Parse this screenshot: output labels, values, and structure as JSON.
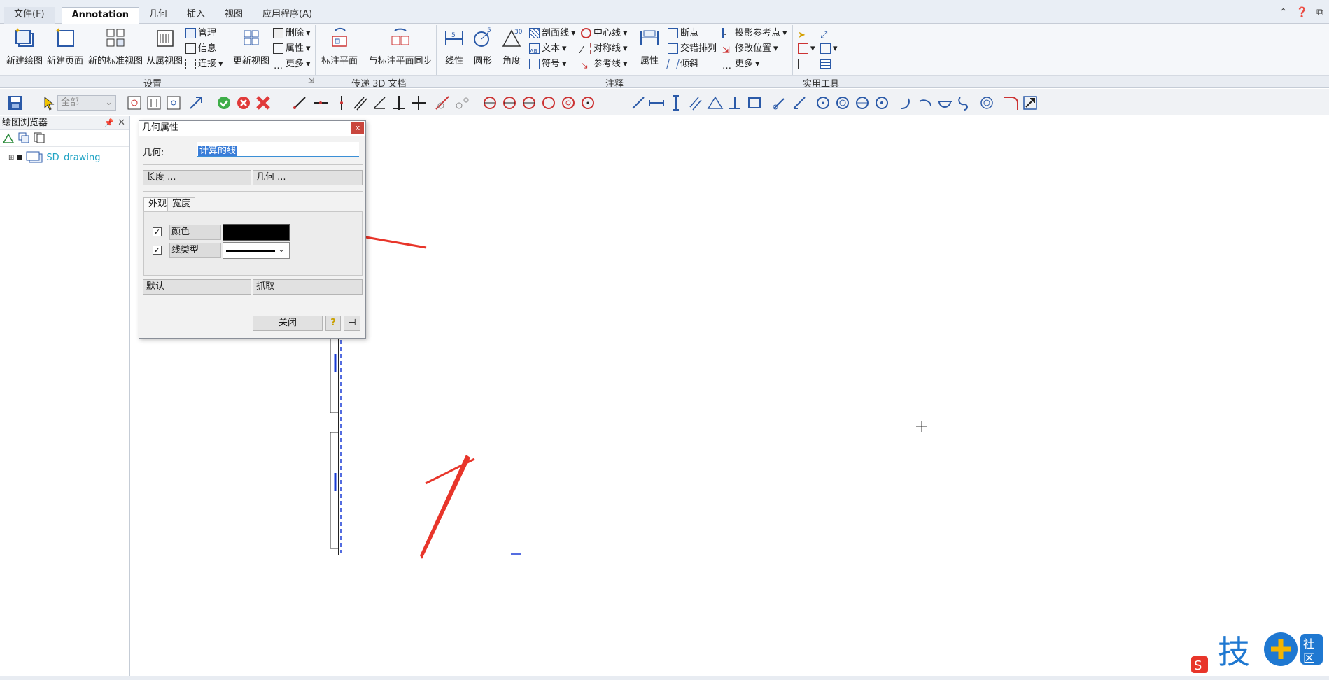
{
  "menu": {
    "file_tab": "文件(F)",
    "tabs": [
      "Annotation",
      "几何",
      "插入",
      "视图",
      "应用程序(A)"
    ],
    "active_tab": "Annotation"
  },
  "ribbon": {
    "groups": {
      "setup": "设置",
      "pmi": "传递 3D 文档",
      "annotation": "注释",
      "utilities": "实用工具"
    },
    "buttons": {
      "new_drawing": "新建绘图",
      "new_page": "新建页面",
      "new_std_view": "新的标准视图",
      "from_prop_view": "从属视图",
      "manage": "管理",
      "info": "信息",
      "connect": "连接",
      "update_view": "更新视图",
      "delete": "删除",
      "properties": "属性",
      "more": "更多",
      "annotation_plane": "标注平面",
      "sync_plane": "与标注平面同步",
      "linear": "线性",
      "circle": "圆形",
      "angle": "角度",
      "hatch": "剖面线",
      "text": "文本",
      "symbol": "符号",
      "centerline": "中心线",
      "symmetry": "对称线",
      "reference": "参考线",
      "attr": "属性",
      "break": "断点",
      "stagger": "交错排列",
      "tilt": "倾斜",
      "proj_ref": "投影参考点",
      "modify_pos": "修改位置",
      "more2": "更多"
    }
  },
  "toolbar": {
    "filter_value": "全部"
  },
  "browser": {
    "title": "绘图浏览器",
    "item": "SD_drawing"
  },
  "dialog": {
    "title": "几何属性",
    "geometry_label": "几何:",
    "geometry_value": "计算的线",
    "length_btn": "长度 ...",
    "geom_btn": "几何 ...",
    "tab_appearance": "外观",
    "tab_width": "宽度",
    "color_label": "颜色",
    "linetype_label": "线类型",
    "default_btn": "默认",
    "grab_btn": "抓取",
    "close_btn": "关闭"
  },
  "colors": {
    "accent": "#3b8fd6",
    "arrow": "#e8352a",
    "blue_lines": "#1a3cd6"
  }
}
